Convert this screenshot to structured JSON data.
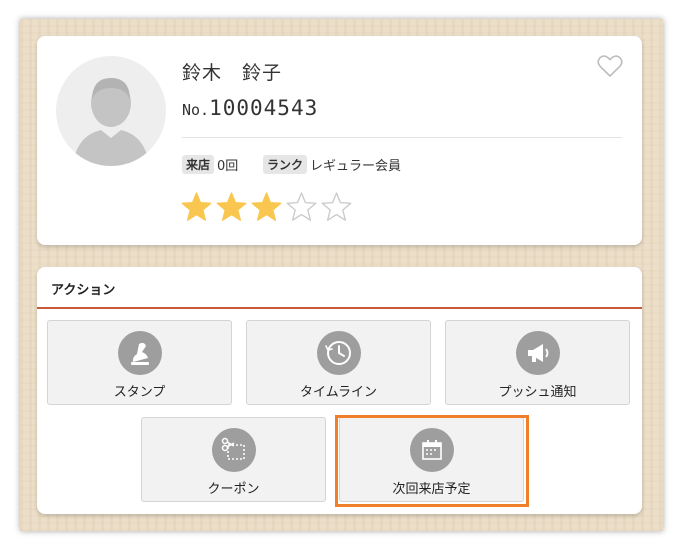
{
  "customer": {
    "name": "鈴木　鈴子",
    "member_prefix": "No.",
    "member_number": "10004543",
    "visits_label": "来店",
    "visits_value": "0回",
    "rank_label": "ランク",
    "rank_value": "レギュラー会員",
    "rating": 3,
    "rating_max": 5
  },
  "actions": {
    "title": "アクション",
    "buttons": [
      {
        "label": "スタンプ",
        "icon": "stamp-icon"
      },
      {
        "label": "タイムライン",
        "icon": "clock-icon"
      },
      {
        "label": "プッシュ通知",
        "icon": "megaphone-icon"
      },
      {
        "label": "クーポン",
        "icon": "scissors-coupon-icon"
      },
      {
        "label": "次回来店予定",
        "icon": "calendar-icon"
      }
    ]
  },
  "colors": {
    "star_filled": "#f9c74f",
    "accent_rule": "#c8593a",
    "highlight": "#f07f2a",
    "icon_circle": "#9e9e9e"
  }
}
